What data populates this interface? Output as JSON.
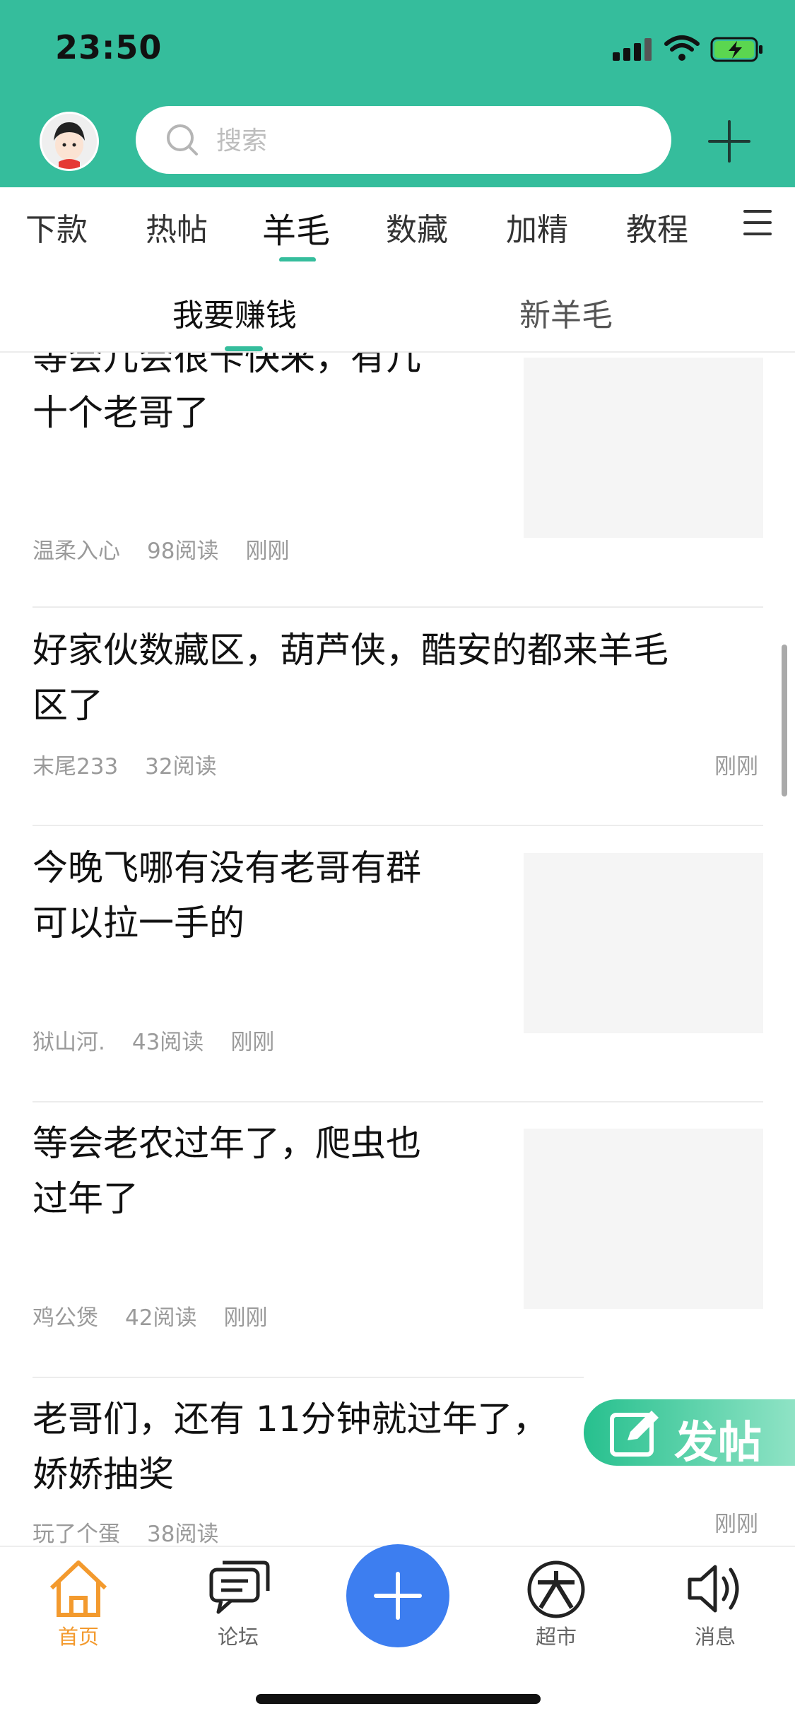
{
  "status_bar": {
    "time": "23:50"
  },
  "header": {
    "search_placeholder": "搜索"
  },
  "tabs": [
    {
      "label": "下款"
    },
    {
      "label": "热帖"
    },
    {
      "label": "羊毛"
    },
    {
      "label": "数藏"
    },
    {
      "label": "加精"
    },
    {
      "label": "教程"
    }
  ],
  "active_tab": "羊毛",
  "subtabs": [
    {
      "label": "我要赚钱"
    },
    {
      "label": "新羊毛"
    }
  ],
  "posts": [
    {
      "title_lines": [
        "等会儿会很卡快来，有几",
        "十个老哥了"
      ],
      "author": "温柔入心",
      "reads": "98阅读",
      "time": "刚刚",
      "has_thumb": true
    },
    {
      "title_lines": [
        "好家伙数藏区，葫芦侠，酷安的都来羊毛",
        "区了"
      ],
      "author": "末尾233",
      "reads": "32阅读",
      "time": "刚刚",
      "has_thumb": false
    },
    {
      "title_lines": [
        "今晚飞哪有没有老哥有群",
        "可以拉一手的"
      ],
      "author": "狱山河.",
      "reads": "43阅读",
      "time": "刚刚",
      "has_thumb": true
    },
    {
      "title_lines": [
        "等会老农过年了，爬虫也",
        "过年了"
      ],
      "author": "鸡公煲",
      "reads": "42阅读",
      "time": "刚刚",
      "has_thumb": true
    },
    {
      "title_lines": [
        "老哥们，还有 11分钟就过年了，",
        "娇娇抽奖"
      ],
      "author": "玩了个蛋",
      "reads": "38阅读",
      "time": "刚刚",
      "has_thumb": false
    }
  ],
  "post_button": {
    "label": "发帖"
  },
  "bottom_nav": [
    {
      "label": "首页",
      "icon": "home-icon",
      "active": true
    },
    {
      "label": "论坛",
      "icon": "chat-icon"
    },
    {
      "label": "超市",
      "icon": "market-icon"
    },
    {
      "label": "消息",
      "icon": "speaker-icon"
    }
  ],
  "colors": {
    "brand": "#35bd9c",
    "active_nav": "#f39a2e",
    "center_button": "#3d7ef0"
  }
}
